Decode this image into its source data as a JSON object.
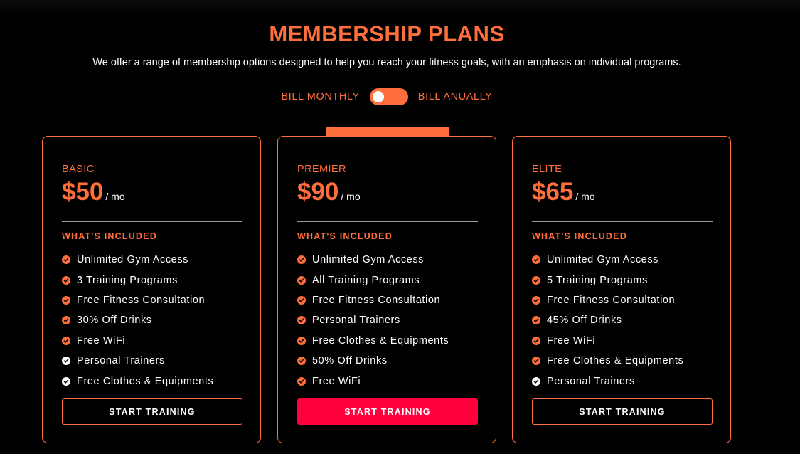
{
  "header": {
    "title": "MEMBERSHIP PLANS",
    "subtitle": "We offer a range of membership options designed to help you reach your fitness goals, with an emphasis on individual programs."
  },
  "billing": {
    "monthly_label": "BILL MONTHLY",
    "annually_label": "BILL ANUALLY",
    "selected": "monthly"
  },
  "colors": {
    "accent": "#ff6f3c",
    "cta": "#ff003c",
    "background": "#000000",
    "included_check": "#ff6f3c",
    "excluded_check": "#ffffff"
  },
  "plans": [
    {
      "name": "BASIC",
      "price": "$50",
      "period": "/ mo",
      "included_label": "WHAT'S INCLUDED",
      "features": [
        {
          "text": "Unlimited Gym Access",
          "icon": "check-circle-icon",
          "highlight": true
        },
        {
          "text": "3 Training Programs",
          "icon": "check-circle-icon",
          "highlight": true
        },
        {
          "text": "Free Fitness Consultation",
          "icon": "check-circle-icon",
          "highlight": true
        },
        {
          "text": "30% Off Drinks",
          "icon": "check-circle-icon",
          "highlight": true
        },
        {
          "text": "Free WiFi",
          "icon": "check-circle-icon",
          "highlight": true
        },
        {
          "text": "Personal Trainers",
          "icon": "check-circle-icon",
          "highlight": false
        },
        {
          "text": "Free Clothes & Equipments",
          "icon": "check-circle-icon",
          "highlight": false
        }
      ],
      "button_label": "START TRAINING",
      "featured": false
    },
    {
      "name": "PREMIER",
      "price": "$90",
      "period": "/ mo",
      "included_label": "WHAT'S INCLUDED",
      "features": [
        {
          "text": "Unlimited Gym Access",
          "icon": "check-circle-icon",
          "highlight": true
        },
        {
          "text": "All Training Programs",
          "icon": "check-circle-icon",
          "highlight": true
        },
        {
          "text": "Free Fitness Consultation",
          "icon": "check-circle-icon",
          "highlight": true
        },
        {
          "text": "Personal Trainers",
          "icon": "check-circle-icon",
          "highlight": true
        },
        {
          "text": "Free Clothes & Equipments",
          "icon": "check-circle-icon",
          "highlight": true
        },
        {
          "text": "50% Off Drinks",
          "icon": "check-circle-icon",
          "highlight": true
        },
        {
          "text": "Free WiFi",
          "icon": "check-circle-icon",
          "highlight": true
        }
      ],
      "button_label": "START TRAINING",
      "featured": true
    },
    {
      "name": "ELITE",
      "price": "$65",
      "period": "/ mo",
      "included_label": "WHAT'S INCLUDED",
      "features": [
        {
          "text": "Unlimited Gym Access",
          "icon": "check-circle-icon",
          "highlight": true
        },
        {
          "text": "5 Training Programs",
          "icon": "check-circle-icon",
          "highlight": true
        },
        {
          "text": "Free Fitness Consultation",
          "icon": "check-circle-icon",
          "highlight": true
        },
        {
          "text": "45% Off Drinks",
          "icon": "check-circle-icon",
          "highlight": true
        },
        {
          "text": "Free WiFi",
          "icon": "check-circle-icon",
          "highlight": true
        },
        {
          "text": "Free Clothes & Equipments",
          "icon": "check-circle-icon",
          "highlight": true
        },
        {
          "text": "Personal Trainers",
          "icon": "check-circle-icon",
          "highlight": false
        }
      ],
      "button_label": "START TRAINING",
      "featured": false
    }
  ]
}
